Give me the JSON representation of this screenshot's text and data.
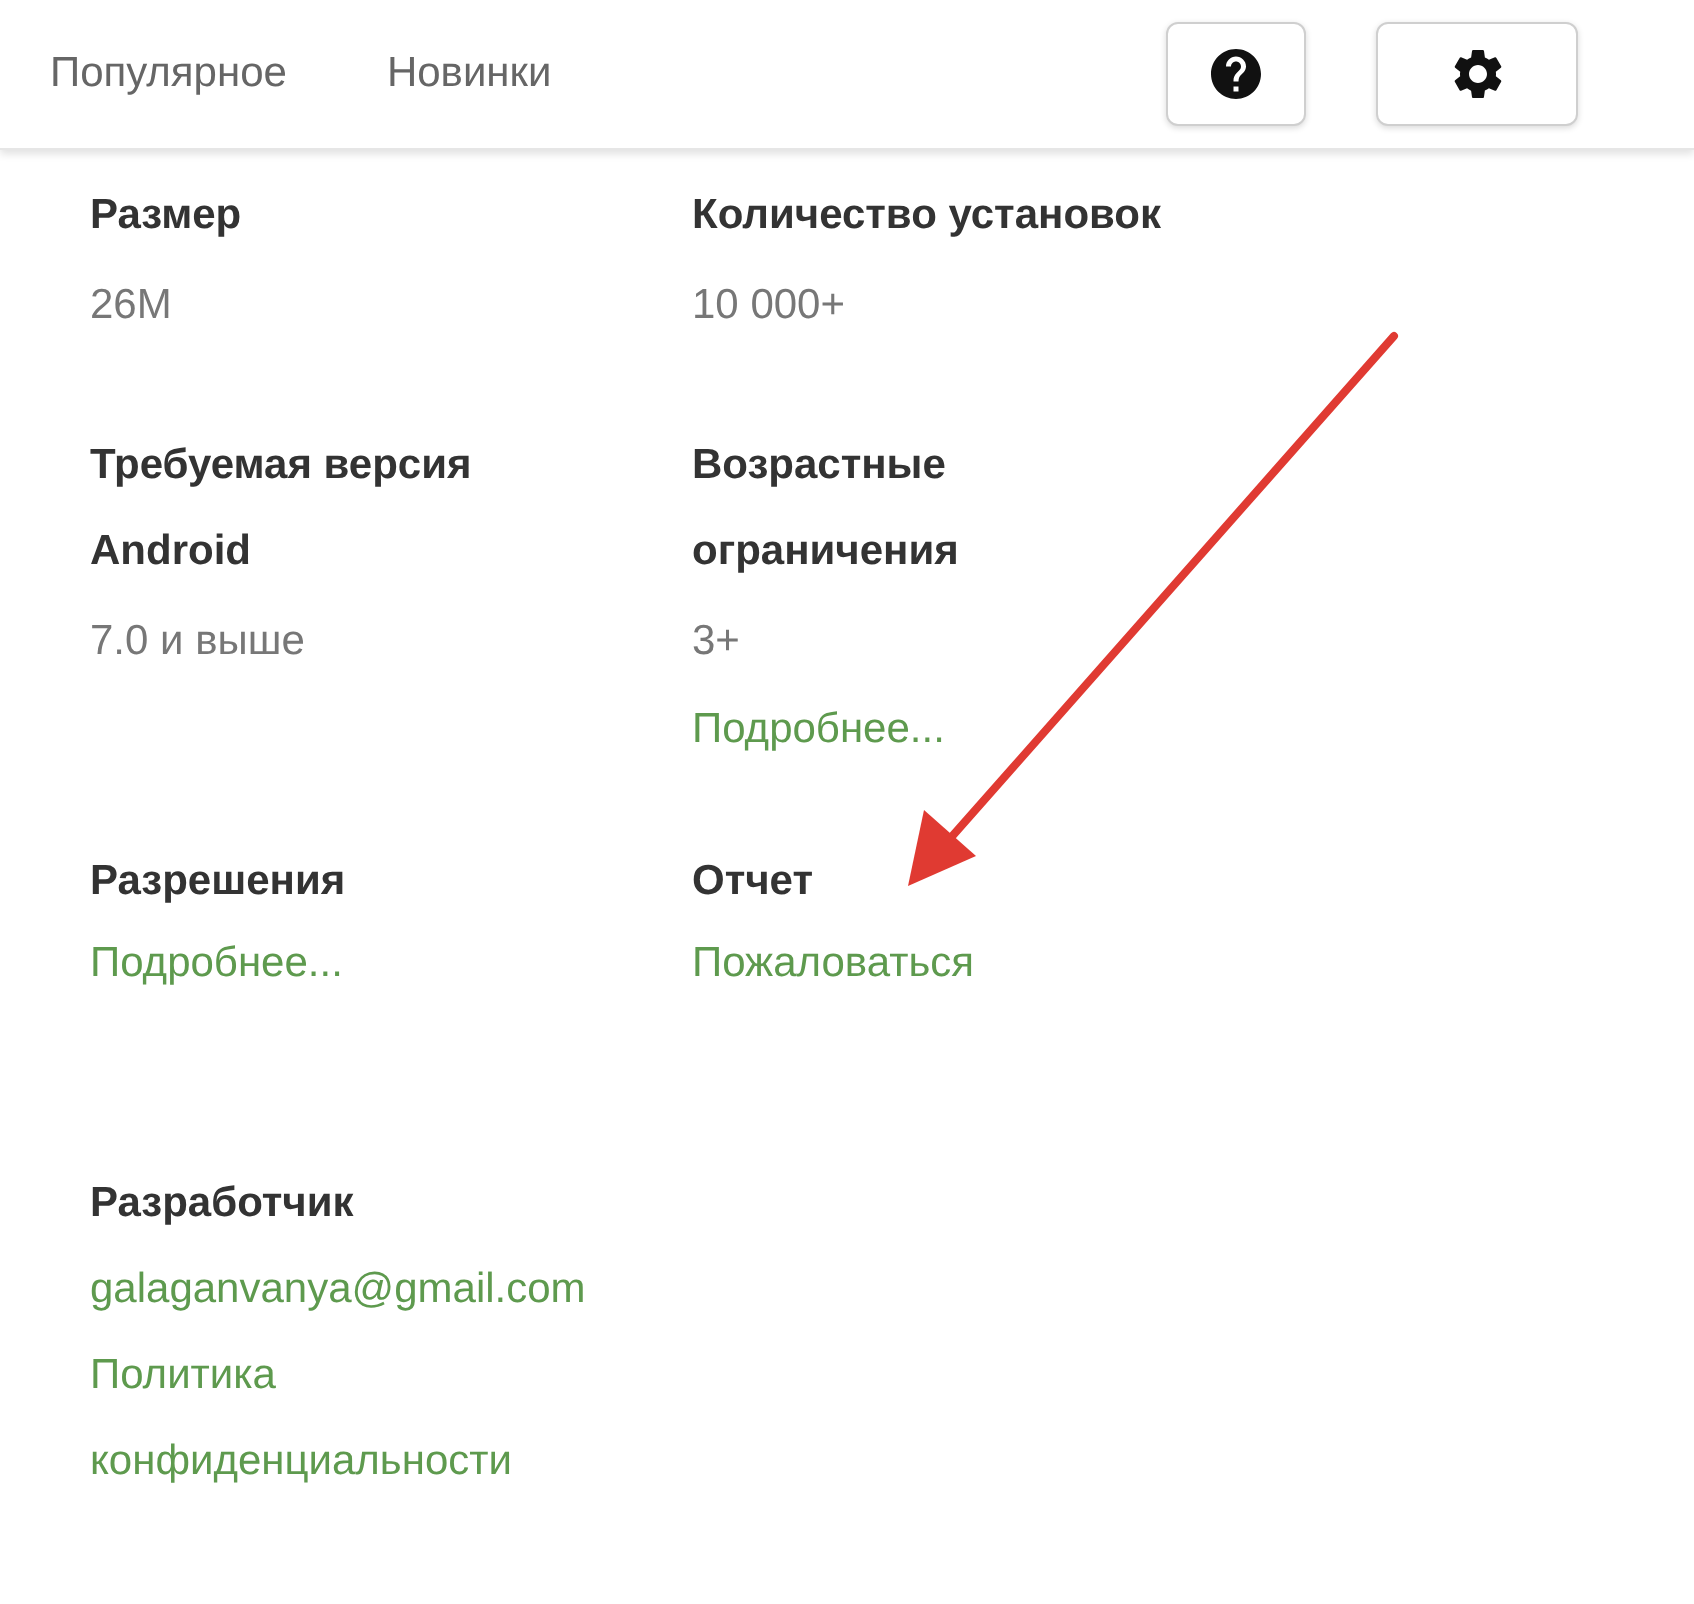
{
  "tabs": [
    {
      "label": "Популярное"
    },
    {
      "label": "Новинки"
    }
  ],
  "details": [
    {
      "label": [
        "Размер"
      ],
      "value": "26M"
    },
    {
      "label": [
        "Количество установок"
      ],
      "value": "10 000+"
    },
    {
      "label": [
        "Требуемая версия",
        "Android"
      ],
      "value": "7.0 и выше"
    },
    {
      "label": [
        "Возрастные",
        "ограничения"
      ],
      "value": "3+",
      "link": "Подробнее..."
    },
    {
      "label": [
        "Разрешения"
      ],
      "link": "Подробнее..."
    },
    {
      "label": [
        "Отчет"
      ],
      "link": "Пожаловаться"
    }
  ],
  "developer": {
    "label": "Разработчик",
    "links": [
      "galaganvanya@gmail.com",
      "Политика",
      "конфиденциальности"
    ]
  }
}
